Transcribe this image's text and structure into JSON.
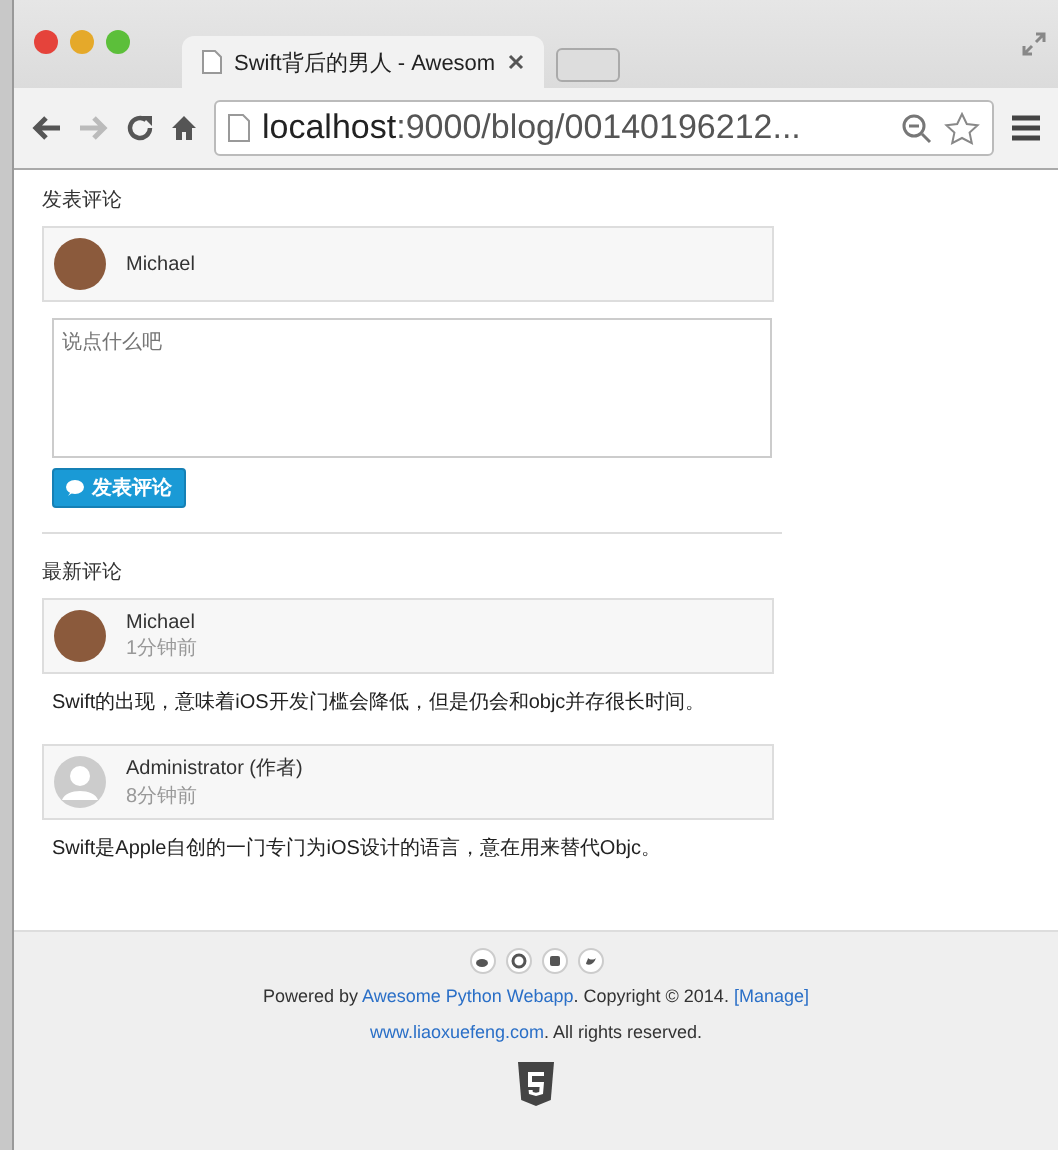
{
  "window": {
    "tab_title": "Swift背后的男人 - Awesom",
    "url_host": "localhost",
    "url_path": ":9000/blog/00140196212..."
  },
  "comment_form": {
    "heading": "发表评论",
    "user": {
      "name": "Michael",
      "avatar": {
        "kind": "photo"
      }
    },
    "placeholder": "说点什么吧",
    "submit": "发表评论"
  },
  "comments": {
    "heading": "最新评论",
    "items": [
      {
        "name": "Michael",
        "time": "1分钟前",
        "avatar": {
          "kind": "photo"
        },
        "text": "Swift的出现，意味着iOS开发门槛会降低，但是仍会和objc并存很长时间。"
      },
      {
        "name": "Administrator (作者)",
        "time": "8分钟前",
        "avatar": {
          "kind": "default"
        },
        "text": "Swift是Apple自创的一门专门为iOS设计的语言，意在用来替代Objc。"
      }
    ]
  },
  "footer": {
    "lines": [
      [
        {
          "text": "Powered by ",
          "link": false
        },
        {
          "text": "Awesome Python Webapp",
          "link": true
        },
        {
          "text": ". Copyright © 2014. ",
          "link": false
        },
        {
          "text": "[Manage]",
          "link": true
        }
      ],
      [
        {
          "text": "www.liaoxuefeng.com",
          "link": true
        },
        {
          "text": ". All rights reserved.",
          "link": false
        }
      ]
    ]
  }
}
